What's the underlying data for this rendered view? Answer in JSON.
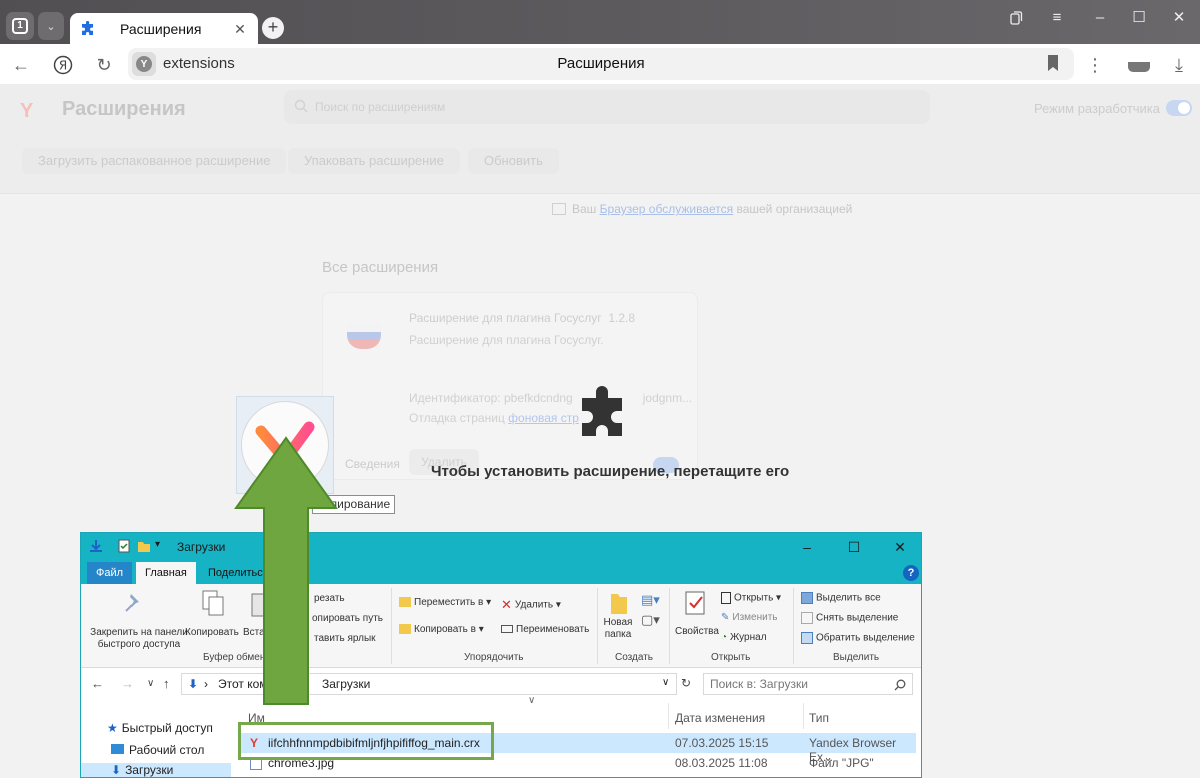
{
  "browser": {
    "tab_count": "1",
    "tab_title": "Расширения",
    "address_url": "extensions",
    "address_title": "Расширения"
  },
  "page": {
    "logo": "Y",
    "title": "Расширения",
    "search_placeholder": "Поиск по расширениям",
    "dev_mode_label": "Режим разработчика",
    "dev_mode_on": true,
    "buttons": [
      "Загрузить распакованное расширение",
      "Упаковать расширение",
      "Обновить"
    ],
    "managed": {
      "prefix": "Ваш",
      "link": "Браузер обслуживается",
      "suffix": "вашей организацией"
    },
    "section_title": "Все расширения",
    "extension": {
      "name": "Расширение для плагина Госуслуг",
      "version": "1.2.8",
      "description": "Расширение для плагина Госуслуг.",
      "id_label": "Идентификатор: pbefkdcndng",
      "id_tail": "jodgnm...",
      "debug_label": "Отладка страниц",
      "debug_link": "фоновая стр",
      "details_button": "Сведения",
      "remove_button": "Удалить",
      "enabled": true
    },
    "drop_overlay_text": "Чтобы установить расширение, перетащите его",
    "drag_tooltip": "Копирование"
  },
  "explorer": {
    "title": "Загрузки",
    "tabs": [
      "Файл",
      "Главная",
      "Поделиться"
    ],
    "ribbon": {
      "pin_label": "Закрепить на панели быстрого доступа",
      "copy_label": "Копировать",
      "paste_label": "Встав",
      "cut_label": "резать",
      "copy_path_label": "опировать путь",
      "paste_shortcut_label": "тавить ярлык",
      "clipboard_group": "Буфер обмен",
      "move_to_label": "Переместить в",
      "copy_to_label": "Копировать в",
      "delete_label": "Удалить",
      "rename_label": "Переименовать",
      "organize_group": "Упорядочить",
      "new_folder_label": "Новая папка",
      "create_group": "Создать",
      "properties_label": "Свойства",
      "open_label": "Открыть",
      "edit_label": "Изменить",
      "history_label": "Журнал",
      "open_group": "Открыть",
      "select_all_label": "Выделить все",
      "select_none_label": "Снять выделение",
      "invert_label": "Обратить выделение",
      "select_group": "Выделить"
    },
    "path_root": "Этот ком",
    "path_current": "Загрузки",
    "search_placeholder": "Поиск в: Загрузки",
    "sidebar": [
      "Быстрый доступ",
      "Рабочий стол",
      "Загрузки"
    ],
    "columns": [
      "Им",
      "Дата изменения",
      "Тип"
    ],
    "files": [
      {
        "name": "iifchhfnnmpdbibifmljnfjhpififfog_main.crx",
        "date": "07.03.2025 15:15",
        "type": "Yandex Browser Ex..."
      },
      {
        "name": "chrome3.jpg",
        "date": "08.03.2025 11:08",
        "type": "Файл \"JPG\""
      }
    ]
  },
  "colors": {
    "titlebar": "#5a585b",
    "explorer_accent": "#16b3c4",
    "highlight_green": "#74a84a",
    "selection": "#cce8ff"
  }
}
